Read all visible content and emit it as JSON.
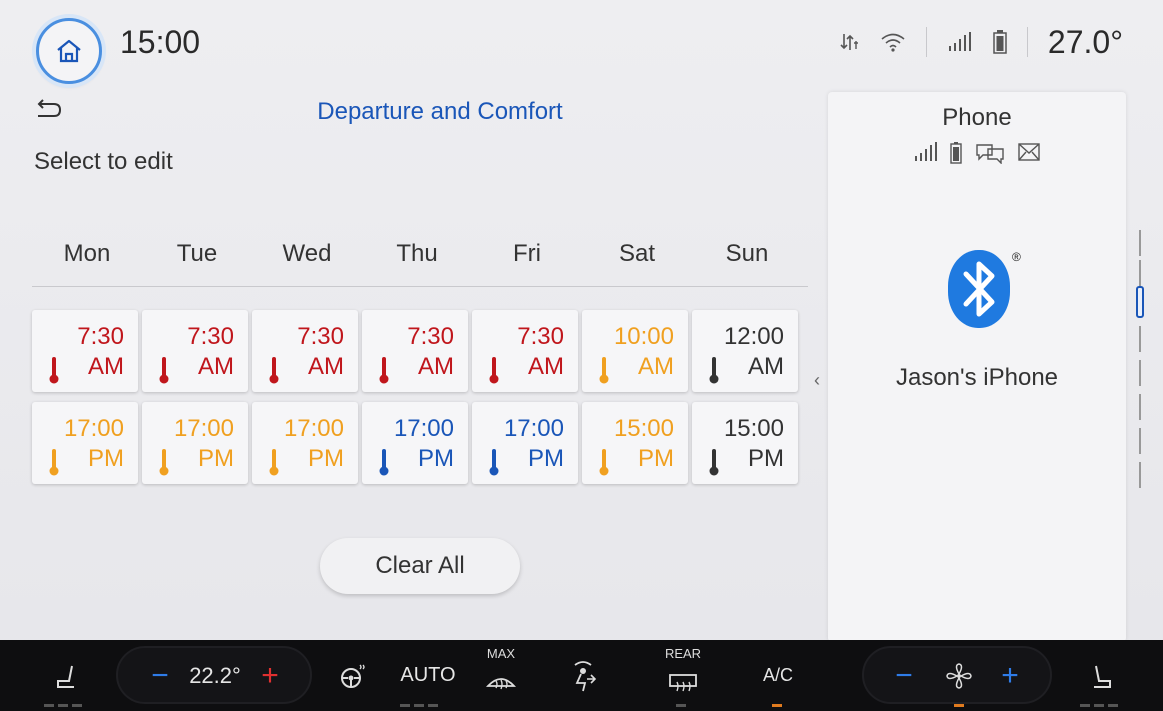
{
  "status_bar": {
    "time": "15:00",
    "outside_temp": "27.0°",
    "icons": [
      "home-icon",
      "data-arrows-icon",
      "wifi-icon",
      "signal-icon",
      "battery-icon"
    ]
  },
  "main": {
    "title": "Departure and Comfort",
    "subtitle": "Select to edit",
    "days": [
      "Mon",
      "Tue",
      "Wed",
      "Thu",
      "Fri",
      "Sat",
      "Sun"
    ],
    "schedule": [
      [
        {
          "time": "7:30",
          "ampm": "AM",
          "color": "#c0161c"
        },
        {
          "time": "7:30",
          "ampm": "AM",
          "color": "#c0161c"
        },
        {
          "time": "7:30",
          "ampm": "AM",
          "color": "#c0161c"
        },
        {
          "time": "7:30",
          "ampm": "AM",
          "color": "#c0161c"
        },
        {
          "time": "7:30",
          "ampm": "AM",
          "color": "#c0161c"
        },
        {
          "time": "10:00",
          "ampm": "AM",
          "color": "#f0a020"
        },
        {
          "time": "12:00",
          "ampm": "AM",
          "color": "#333333"
        }
      ],
      [
        {
          "time": "17:00",
          "ampm": "PM",
          "color": "#f0a020"
        },
        {
          "time": "17:00",
          "ampm": "PM",
          "color": "#f0a020"
        },
        {
          "time": "17:00",
          "ampm": "PM",
          "color": "#f0a020"
        },
        {
          "time": "17:00",
          "ampm": "PM",
          "color": "#1a56b8"
        },
        {
          "time": "17:00",
          "ampm": "PM",
          "color": "#1a56b8"
        },
        {
          "time": "15:00",
          "ampm": "PM",
          "color": "#f0a020"
        },
        {
          "time": "15:00",
          "ampm": "PM",
          "color": "#333333"
        }
      ]
    ],
    "clear_all_label": "Clear All"
  },
  "phone_panel": {
    "title": "Phone",
    "device_name": "Jason's iPhone",
    "icons": [
      "signal-icon",
      "battery-icon",
      "messages-icon",
      "mail-icon"
    ],
    "bluetooth_color": "#1f7ae0"
  },
  "climate_bar": {
    "driver_temp": "22.2°",
    "auto_label": "AUTO",
    "max_label": "MAX",
    "rear_label": "REAR",
    "ac_label": "A/C"
  }
}
